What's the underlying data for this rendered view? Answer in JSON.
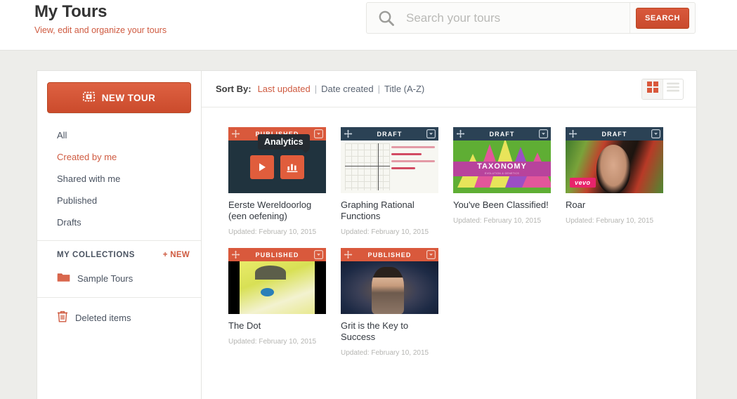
{
  "header": {
    "title": "My Tours",
    "subtitle": "View, edit and organize your tours",
    "search": {
      "placeholder": "Search your tours",
      "value": "",
      "button_label": "SEARCH",
      "icon": "search-icon"
    }
  },
  "sidebar": {
    "new_tour_label": "NEW TOUR",
    "new_tour_icon": "add-slide-icon",
    "items": [
      {
        "label": "All",
        "active": false
      },
      {
        "label": "Created by me",
        "active": true
      },
      {
        "label": "Shared with me",
        "active": false
      },
      {
        "label": "Published",
        "active": false
      },
      {
        "label": "Drafts",
        "active": false
      }
    ],
    "collections": {
      "title": "MY COLLECTIONS",
      "new_label": "+ NEW",
      "items": [
        {
          "label": "Sample Tours",
          "icon": "folder-icon"
        }
      ]
    },
    "deleted": {
      "label": "Deleted items",
      "icon": "trash-icon"
    }
  },
  "toolbar": {
    "sort_label": "Sort By:",
    "separator": "|",
    "sort_options": [
      {
        "label": "Last updated",
        "active": true
      },
      {
        "label": "Date created",
        "active": false
      },
      {
        "label": "Title (A-Z)",
        "active": false
      }
    ],
    "views": [
      {
        "name": "grid-view",
        "icon": "grid-icon",
        "active": true
      },
      {
        "name": "list-view",
        "icon": "list-icon",
        "active": false
      }
    ]
  },
  "colors": {
    "accent": "#cf5b41",
    "published_header": "#d9593c",
    "draft_header": "#2b4255",
    "page_background": "#ededea",
    "panel": "#ffffff"
  },
  "tours": [
    {
      "title": "Eerste Wereldoorlog (een oefening)",
      "status": "PUBLISHED",
      "status_type": "published",
      "updated": "Updated: February 10, 2015",
      "thumb": "th-war",
      "hovered": true,
      "tooltip": "Analytics",
      "overlay_buttons": [
        "play-icon",
        "analytics-icon"
      ]
    },
    {
      "title": "Graphing Rational Functions",
      "status": "DRAFT",
      "status_type": "draft",
      "updated": "Updated: February 10, 2015",
      "thumb": "th-graph",
      "hovered": false
    },
    {
      "title": "You've Been Classified!",
      "status": "DRAFT",
      "status_type": "draft",
      "updated": "Updated: February 10, 2015",
      "thumb": "th-tax",
      "thumb_text": "TAXONOMY",
      "thumb_subtext": "EVOLUTION & GENETICS",
      "hovered": false
    },
    {
      "title": "Roar",
      "status": "DRAFT",
      "status_type": "draft",
      "updated": "Updated: February 10, 2015",
      "thumb": "th-roar",
      "thumb_text": "vevo",
      "hovered": false
    },
    {
      "title": "The Dot",
      "status": "PUBLISHED",
      "status_type": "published",
      "updated": "Updated: February 10, 2015",
      "thumb": "th-dot",
      "hovered": false
    },
    {
      "title": "Grit is the Key to Success",
      "status": "PUBLISHED",
      "status_type": "published",
      "updated": "Updated: February 10, 2015",
      "thumb": "th-grit",
      "hovered": false
    }
  ]
}
